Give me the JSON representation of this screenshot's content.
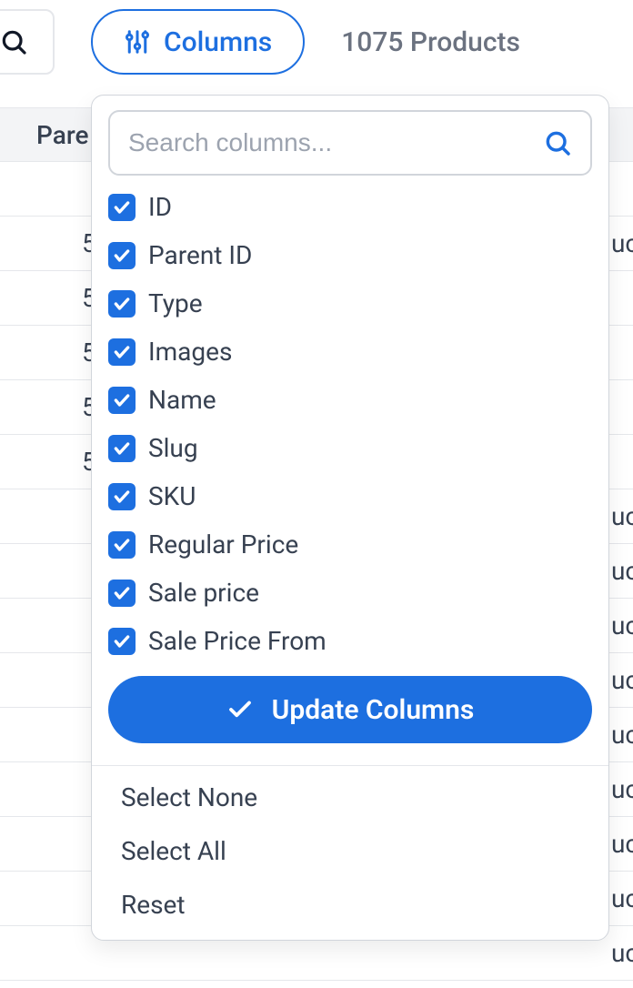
{
  "toolbar": {
    "columns_label": "Columns",
    "product_count": "1075 Products"
  },
  "table": {
    "header": "Pare",
    "rows": [
      {
        "left": "",
        "right": ""
      },
      {
        "left": "5",
        "right": "uc"
      },
      {
        "left": "5",
        "right": ""
      },
      {
        "left": "5",
        "right": ""
      },
      {
        "left": "5",
        "right": ""
      },
      {
        "left": "5",
        "right": ""
      },
      {
        "left": "",
        "right": "uc"
      },
      {
        "left": "",
        "right": "uc"
      },
      {
        "left": "",
        "right": "uc"
      },
      {
        "left": "",
        "right": "uc"
      },
      {
        "left": "",
        "right": "uc"
      },
      {
        "left": "",
        "right": "uc"
      },
      {
        "left": "",
        "right": "uc"
      },
      {
        "left": "",
        "right": "uc"
      },
      {
        "left": "",
        "right": "uc"
      }
    ]
  },
  "dropdown": {
    "search_placeholder": "Search columns...",
    "columns": [
      {
        "label": "ID",
        "checked": true
      },
      {
        "label": "Parent ID",
        "checked": true
      },
      {
        "label": "Type",
        "checked": true
      },
      {
        "label": "Images",
        "checked": true
      },
      {
        "label": "Name",
        "checked": true
      },
      {
        "label": "Slug",
        "checked": true
      },
      {
        "label": "SKU",
        "checked": true
      },
      {
        "label": "Regular Price",
        "checked": true
      },
      {
        "label": "Sale price",
        "checked": true
      },
      {
        "label": "Sale Price From",
        "checked": true
      }
    ],
    "update_label": "Update Columns",
    "actions": {
      "select_none": "Select None",
      "select_all": "Select All",
      "reset": "Reset"
    }
  }
}
